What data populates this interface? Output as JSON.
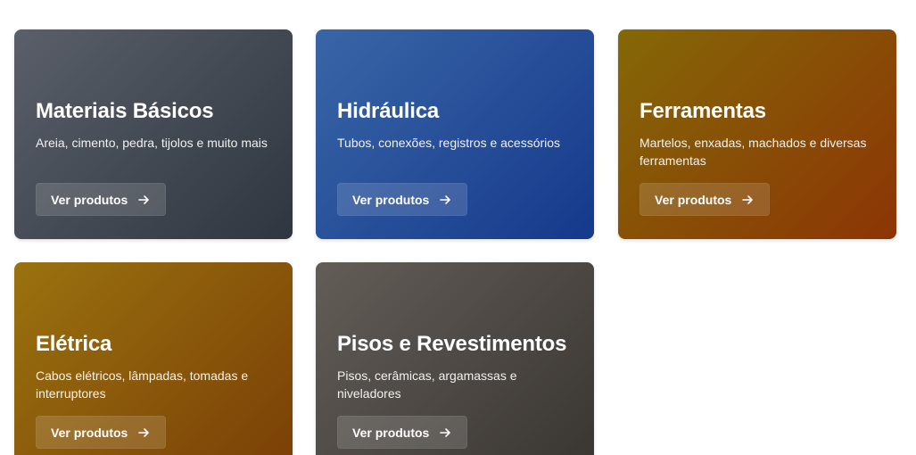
{
  "categories": [
    {
      "title": "Materiais Básicos",
      "description": "Areia, cimento, pedra, tijolos e muito mais",
      "button_label": "Ver produtos",
      "color_start": "#5a5f69",
      "color_end": "#2f3640"
    },
    {
      "title": "Hidráulica",
      "description": "Tubos, conexões, registros e acessórios",
      "button_label": "Ver produtos",
      "color_start": "#3966a7",
      "color_end": "#15398b"
    },
    {
      "title": "Ferramentas",
      "description": "Martelos, enxadas, machados e diversas ferramentas",
      "button_label": "Ver produtos",
      "color_start": "#846806",
      "color_end": "#8c3505"
    },
    {
      "title": "Elétrica",
      "description": "Cabos elétricos, lâmpadas, tomadas e interruptores",
      "button_label": "Ver produtos",
      "color_start": "#9a720f",
      "color_end": "#7a3f06"
    },
    {
      "title": "Pisos e Revestimentos",
      "description": "Pisos, cerâmicas, argamassas e niveladores",
      "button_label": "Ver produtos",
      "color_start": "#635d58",
      "color_end": "#393531"
    }
  ],
  "icons": {
    "button_icon": "arrow-right-icon"
  }
}
